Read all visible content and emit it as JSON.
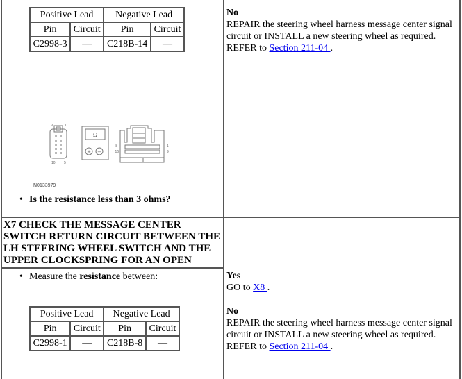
{
  "step_x6": {
    "resistance_table": {
      "group_headers": [
        "Positive Lead",
        "Negative Lead"
      ],
      "column_headers": [
        "Pin",
        "Circuit",
        "Pin",
        "Circuit"
      ],
      "row": [
        "C2998-3",
        "—",
        "C218B-14",
        "—"
      ]
    },
    "figure": {
      "id": "N0133979",
      "left_connector_labels": [
        "9",
        "1",
        "10",
        "5"
      ],
      "meter_symbol": "Ω",
      "meter_buttons": [
        "+",
        "−"
      ],
      "right_connector_labels": [
        "8",
        "16",
        "1",
        "9"
      ]
    },
    "question": "Is the resistance less than 3 ohms?",
    "no_response": {
      "label": "No",
      "text": "REPAIR the steering wheel harness message center signal circuit or INSTALL a new steering wheel as required. REFER to ",
      "link": "Section 211-04 ",
      "suffix": "."
    }
  },
  "step_x7": {
    "title": "X7 CHECK THE MESSAGE CENTER SWITCH RETURN CIRCUIT BETWEEN THE LH STEERING WHEEL SWITCH AND THE UPPER CLOCKSPRING FOR AN OPEN",
    "instruction_prefix": "Measure the ",
    "instruction_bold": "resistance",
    "instruction_suffix": " between:",
    "resistance_table": {
      "group_headers": [
        "Positive Lead",
        "Negative Lead"
      ],
      "column_headers": [
        "Pin",
        "Circuit",
        "Pin",
        "Circuit"
      ],
      "row": [
        "C2998-1",
        "—",
        "C218B-8",
        "—"
      ]
    },
    "yes_response": {
      "label": "Yes",
      "text": "GO to ",
      "link": "X8 ",
      "suffix": "."
    },
    "no_response": {
      "label": "No",
      "text": "REPAIR the steering wheel harness message center signal circuit or INSTALL a new steering wheel as required. REFER to ",
      "link": "Section 211-04 ",
      "suffix": "."
    }
  },
  "colors": {
    "border": "#555555",
    "link": "#0000ee"
  }
}
